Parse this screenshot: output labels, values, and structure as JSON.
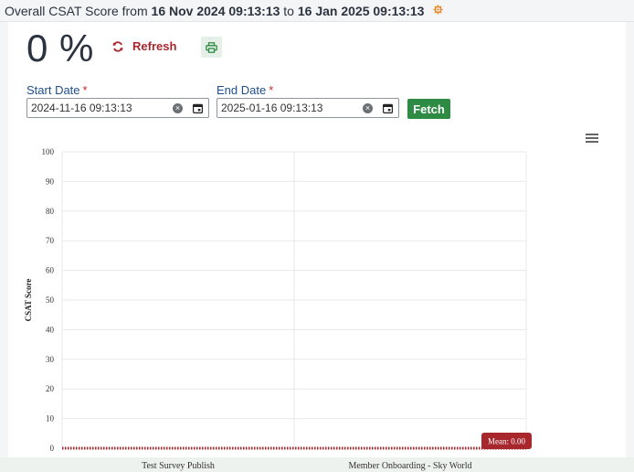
{
  "header": {
    "prefix": "Overall CSAT Score from",
    "start": "16 Nov 2024 09:13:13",
    "connector": "to",
    "end": "16 Jan 2025 09:13:13"
  },
  "score": {
    "value": "0 %"
  },
  "actions": {
    "refresh_label": "Refresh"
  },
  "filters": {
    "start_label": "Start Date",
    "start_value": "2024-11-16 09:13:13",
    "end_label": "End Date",
    "end_value": "2025-01-16 09:13:13",
    "required_mark": "*",
    "fetch_label": "Fetch"
  },
  "chart_data": {
    "type": "bar",
    "categories": [
      "Test Survey Publish",
      "Member Onboarding - Sky World"
    ],
    "values": [
      0,
      0
    ],
    "ylabel": "CSAT Score",
    "xlabel": "",
    "ylim": [
      0,
      100
    ],
    "yticks": [
      0,
      10,
      20,
      30,
      40,
      50,
      60,
      70,
      80,
      90,
      100
    ],
    "grid": true,
    "mean_label": "Mean: 0.00",
    "mean_value": 0,
    "colors": {
      "mean": "#a8272d",
      "grid": "#e8e8e8"
    }
  }
}
